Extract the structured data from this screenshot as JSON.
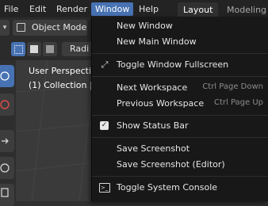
{
  "menubar": {
    "items": [
      {
        "label": "File"
      },
      {
        "label": "Edit"
      },
      {
        "label": "Render"
      },
      {
        "label": "Window",
        "active": true
      },
      {
        "label": "Help"
      }
    ],
    "workspace_tabs": [
      {
        "label": "Layout",
        "active": true
      },
      {
        "label": "Modeling"
      }
    ]
  },
  "toolbar": {
    "mode_label": "Object Mode",
    "radius_button_partial": "Radi"
  },
  "viewport": {
    "view_name": "User Perspectiv",
    "collection_info": "(1) Collection | "
  },
  "window_menu": {
    "items": [
      {
        "label": "New Window",
        "shortcut": "",
        "icon": ""
      },
      {
        "label": "New Main Window",
        "shortcut": "",
        "icon": ""
      },
      {
        "label": "Toggle Window Fullscreen",
        "shortcut": "",
        "icon": "fullscreen-icon"
      },
      {
        "label": "Next Workspace",
        "shortcut": "Ctrl Page Down",
        "icon": ""
      },
      {
        "label": "Previous Workspace",
        "shortcut": "Ctrl Page Up",
        "icon": ""
      },
      {
        "label": "Show Status Bar",
        "shortcut": "",
        "icon": "checkbox-checked-icon",
        "checked": true
      },
      {
        "label": "Save Screenshot",
        "shortcut": "",
        "icon": ""
      },
      {
        "label": "Save Screenshot (Editor)",
        "shortcut": "",
        "icon": ""
      },
      {
        "label": "Toggle System Console",
        "shortcut": "",
        "icon": "console-icon"
      }
    ]
  },
  "colors": {
    "accent": "#4772b3",
    "menu_bg": "#181818",
    "topbar_bg": "#232323"
  }
}
